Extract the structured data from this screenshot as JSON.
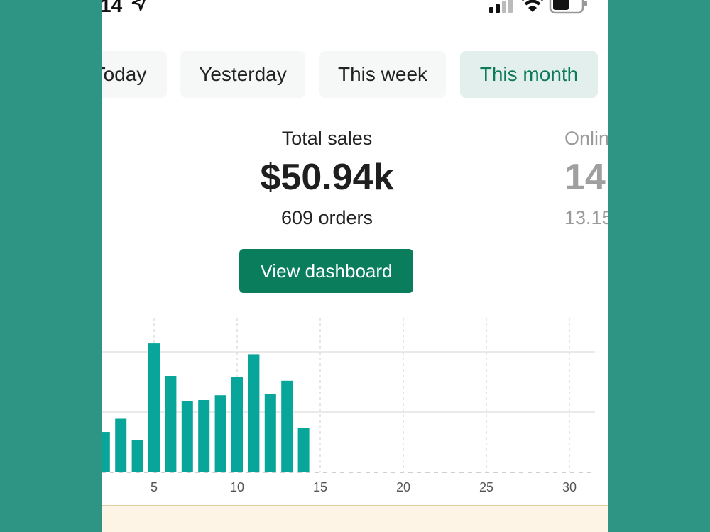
{
  "status": {
    "time": "14"
  },
  "tabs": [
    {
      "label": "Today",
      "active": false
    },
    {
      "label": "Yesterday",
      "active": false
    },
    {
      "label": "This week",
      "active": false
    },
    {
      "label": "This month",
      "active": true
    }
  ],
  "sales": {
    "label": "Total sales",
    "value": "$50.94k",
    "orders": "609 orders",
    "button": "View dashboard"
  },
  "online": {
    "label": "Onlin",
    "value": "14",
    "sub": "13.15"
  },
  "colors": {
    "accent": "#0a7d5d",
    "bar": "#07a59a",
    "background": "#2e9484"
  },
  "chart_data": {
    "type": "bar",
    "x": [
      3,
      4,
      5,
      6,
      7,
      8,
      9,
      10,
      11,
      12,
      13,
      14
    ],
    "values": [
      0.67,
      0.9,
      0.54,
      2.14,
      1.6,
      1.18,
      1.2,
      1.28,
      1.58,
      1.96,
      1.3,
      1.52,
      0.73
    ],
    "x_for_values": [
      2,
      3,
      4,
      5,
      6,
      7,
      8,
      9,
      10,
      11,
      12,
      13,
      14
    ],
    "xticks": [
      "5",
      "10",
      "15",
      "20",
      "25",
      "30"
    ],
    "xtick_values": [
      5,
      10,
      15,
      20,
      25,
      30
    ],
    "xlim": [
      1.5,
      31.5
    ],
    "ylim": [
      0,
      2
    ],
    "grid": true
  }
}
